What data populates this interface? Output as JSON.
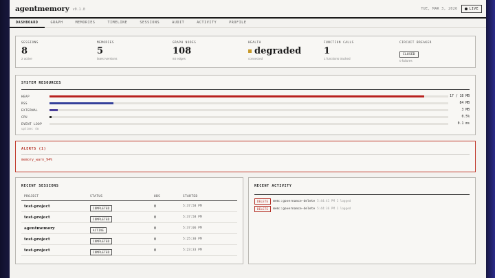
{
  "app": {
    "brand": "agentmemory",
    "version": "v0.1.0",
    "date": "TUE, MAR 3, 2026",
    "live_label": "LIVE"
  },
  "nav": {
    "tabs": [
      {
        "label": "DASHBOARD",
        "active": true
      },
      {
        "label": "GRAPH"
      },
      {
        "label": "MEMORIES"
      },
      {
        "label": "TIMELINE"
      },
      {
        "label": "SESSIONS"
      },
      {
        "label": "AUDIT"
      },
      {
        "label": "ACTIVITY"
      },
      {
        "label": "PROFILE"
      }
    ]
  },
  "stats": {
    "sessions": {
      "label": "SESSIONS",
      "value": "8",
      "sub": "2 active"
    },
    "memories": {
      "label": "MEMORIES",
      "value": "5",
      "sub": "latest versions"
    },
    "graph_nodes": {
      "label": "GRAPH NODES",
      "value": "108",
      "sub": "84 edges"
    },
    "health": {
      "label": "HEALTH",
      "value": "degraded",
      "sub": "connected",
      "indicator_color": "#c89a2a"
    },
    "function_calls": {
      "label": "FUNCTION CALLS",
      "value": "1",
      "sub": "1 functions tracked"
    },
    "circuit_breaker": {
      "label": "CIRCUIT BREAKER",
      "value": "CLOSED",
      "sub": "0 failures"
    }
  },
  "resources": {
    "title": "SYSTEM RESOURCES",
    "rows": [
      {
        "label": "HEAP",
        "value": "17 / 18 MB",
        "fraction": 0.94,
        "color": "#b8221f"
      },
      {
        "label": "RSS",
        "value": "84 MB",
        "fraction": 0.16,
        "color": "#34409a"
      },
      {
        "label": "EXTERNAL",
        "value": "3 MB",
        "fraction": 0.02,
        "color": "#4b3f9a"
      },
      {
        "label": "CPU",
        "value": "0.5%",
        "fraction": 0.005,
        "color": "#222222"
      },
      {
        "label": "EVENT LOOP",
        "value": "0.1 ms",
        "fraction": 0.0,
        "color": "#222222"
      }
    ],
    "footer": "uptime: 4m"
  },
  "alerts": {
    "title": "ALERTS (1)",
    "items": [
      "memory_warn_94%"
    ]
  },
  "recent_sessions": {
    "title": "RECENT SESSIONS",
    "columns": [
      "PROJECT",
      "STATUS",
      "OBS",
      "STARTED"
    ],
    "rows": [
      {
        "project": "test-project",
        "status": "COMPLETED",
        "obs": "0",
        "started": "5:37:58 PM"
      },
      {
        "project": "test-project",
        "status": "COMPLETED",
        "obs": "0",
        "started": "5:37:58 PM"
      },
      {
        "project": "agentmemory",
        "status": "ACTIVE",
        "obs": "0",
        "started": "5:37:06 PM"
      },
      {
        "project": "test-project",
        "status": "COMPLETED",
        "obs": "0",
        "started": "5:25:30 PM"
      },
      {
        "project": "test-project",
        "status": "COMPLETED",
        "obs": "0",
        "started": "5:23:33 PM"
      }
    ]
  },
  "recent_activity": {
    "title": "RECENT ACTIVITY",
    "rows": [
      {
        "badge": "DELETE",
        "text": "mem::governance-delete",
        "meta": "5:44:41 PM 1 logged"
      },
      {
        "badge": "DELETE",
        "text": "mem::governance-delete",
        "meta": "5:44:36 PM 1 logged"
      }
    ]
  }
}
